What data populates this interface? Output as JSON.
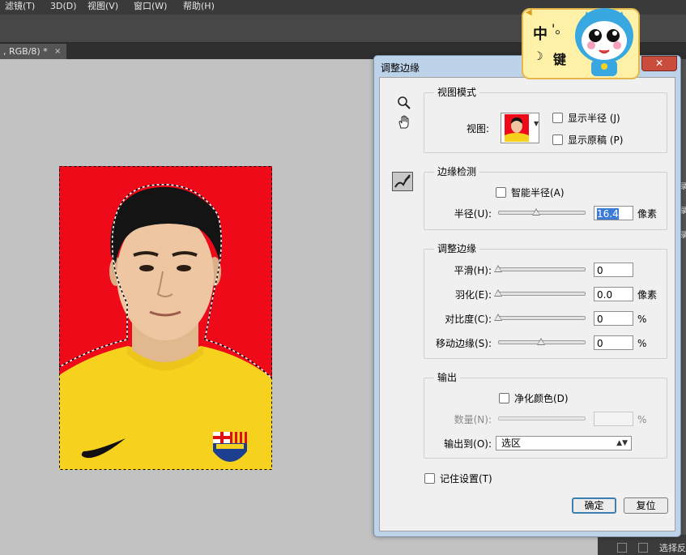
{
  "menubar": {
    "items": [
      "滤镜(T)",
      "3D(D)",
      "视图(V)",
      "窗口(W)",
      "帮助(H)"
    ]
  },
  "document": {
    "tab_title": ", RGB/8) *",
    "close_symbol": "×"
  },
  "ime": {
    "mode": "中",
    "punct": "'。",
    "key_label": "键",
    "moon": "☽"
  },
  "dialog": {
    "title": "调整边缘",
    "close_symbol": "✕",
    "view_mode": {
      "label": "视图模式",
      "view_label": "视图:",
      "show_radius": "显示半径 (J)",
      "show_original": "显示原稿 (P)",
      "show_radius_checked": false,
      "show_original_checked": false
    },
    "edge_detection": {
      "label": "边缘检测",
      "smart_radius": "智能半径(A)",
      "smart_radius_checked": false,
      "radius_label": "半径(U):",
      "radius_value": "16.4",
      "radius_unit": "像素",
      "radius_slider_pct": 44
    },
    "adjust_edge": {
      "label": "调整边缘",
      "rows": [
        {
          "label": "平滑(H):",
          "value": "0",
          "unit": "",
          "slider_pct": 0
        },
        {
          "label": "羽化(E):",
          "value": "0.0",
          "unit": "像素",
          "slider_pct": 0
        },
        {
          "label": "对比度(C):",
          "value": "0",
          "unit": "%",
          "slider_pct": 0
        },
        {
          "label": "移动边缘(S):",
          "value": "0",
          "unit": "%",
          "slider_pct": 50
        }
      ]
    },
    "output": {
      "label": "输出",
      "decontaminate": "净化颜色(D)",
      "decontaminate_checked": false,
      "amount_label": "数量(N):",
      "amount_unit": "%",
      "output_to_label": "输出到(O):",
      "output_to_value": "选区"
    },
    "remember": "记住设置(T)",
    "remember_checked": false,
    "ok": "确定",
    "reset": "复位"
  },
  "panel": {
    "right_labels": [
      "录",
      "录",
      "录"
    ],
    "bottom_text": "选择反"
  },
  "colors": {
    "photo_background": "#ef0a1a",
    "jersey": "#f6d21e",
    "accent_blue": "#3c7fb1"
  }
}
